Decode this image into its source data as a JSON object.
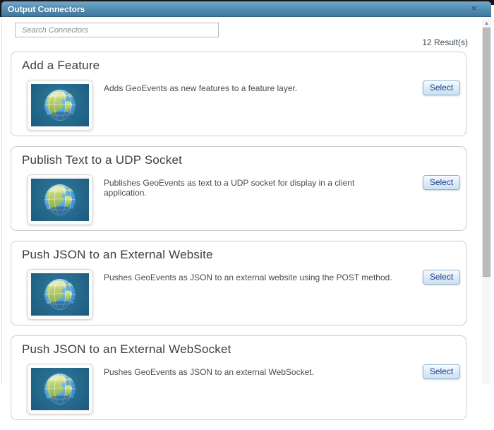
{
  "window": {
    "title": "Output Connectors"
  },
  "icons": {
    "close_icon": "✕",
    "scroll_up_icon": "▲",
    "thumbnail_icon": "globe"
  },
  "search": {
    "placeholder": "Search Connectors",
    "value": ""
  },
  "results_count": "12 Result(s)",
  "colors": {
    "titlebar_gradient_top": "#74a9cb",
    "titlebar_gradient_bottom": "#41769c",
    "thumbnail_background": "#266d90",
    "button_border": "#8fb3d4",
    "button_text": "#1b3e8f"
  },
  "connectors": [
    {
      "title": "Add a Feature",
      "description": "Adds GeoEvents as new features to a feature layer.",
      "action_label": "Select"
    },
    {
      "title": "Publish Text to a UDP Socket",
      "description": "Publishes GeoEvents as text to a UDP socket for display in a client application.",
      "action_label": "Select"
    },
    {
      "title": "Push JSON to an External Website",
      "description": "Pushes GeoEvents as JSON to an external website using the POST method.",
      "action_label": "Select"
    },
    {
      "title": "Push JSON to an External WebSocket",
      "description": "Pushes GeoEvents as JSON to an external WebSocket.",
      "action_label": "Select"
    }
  ]
}
